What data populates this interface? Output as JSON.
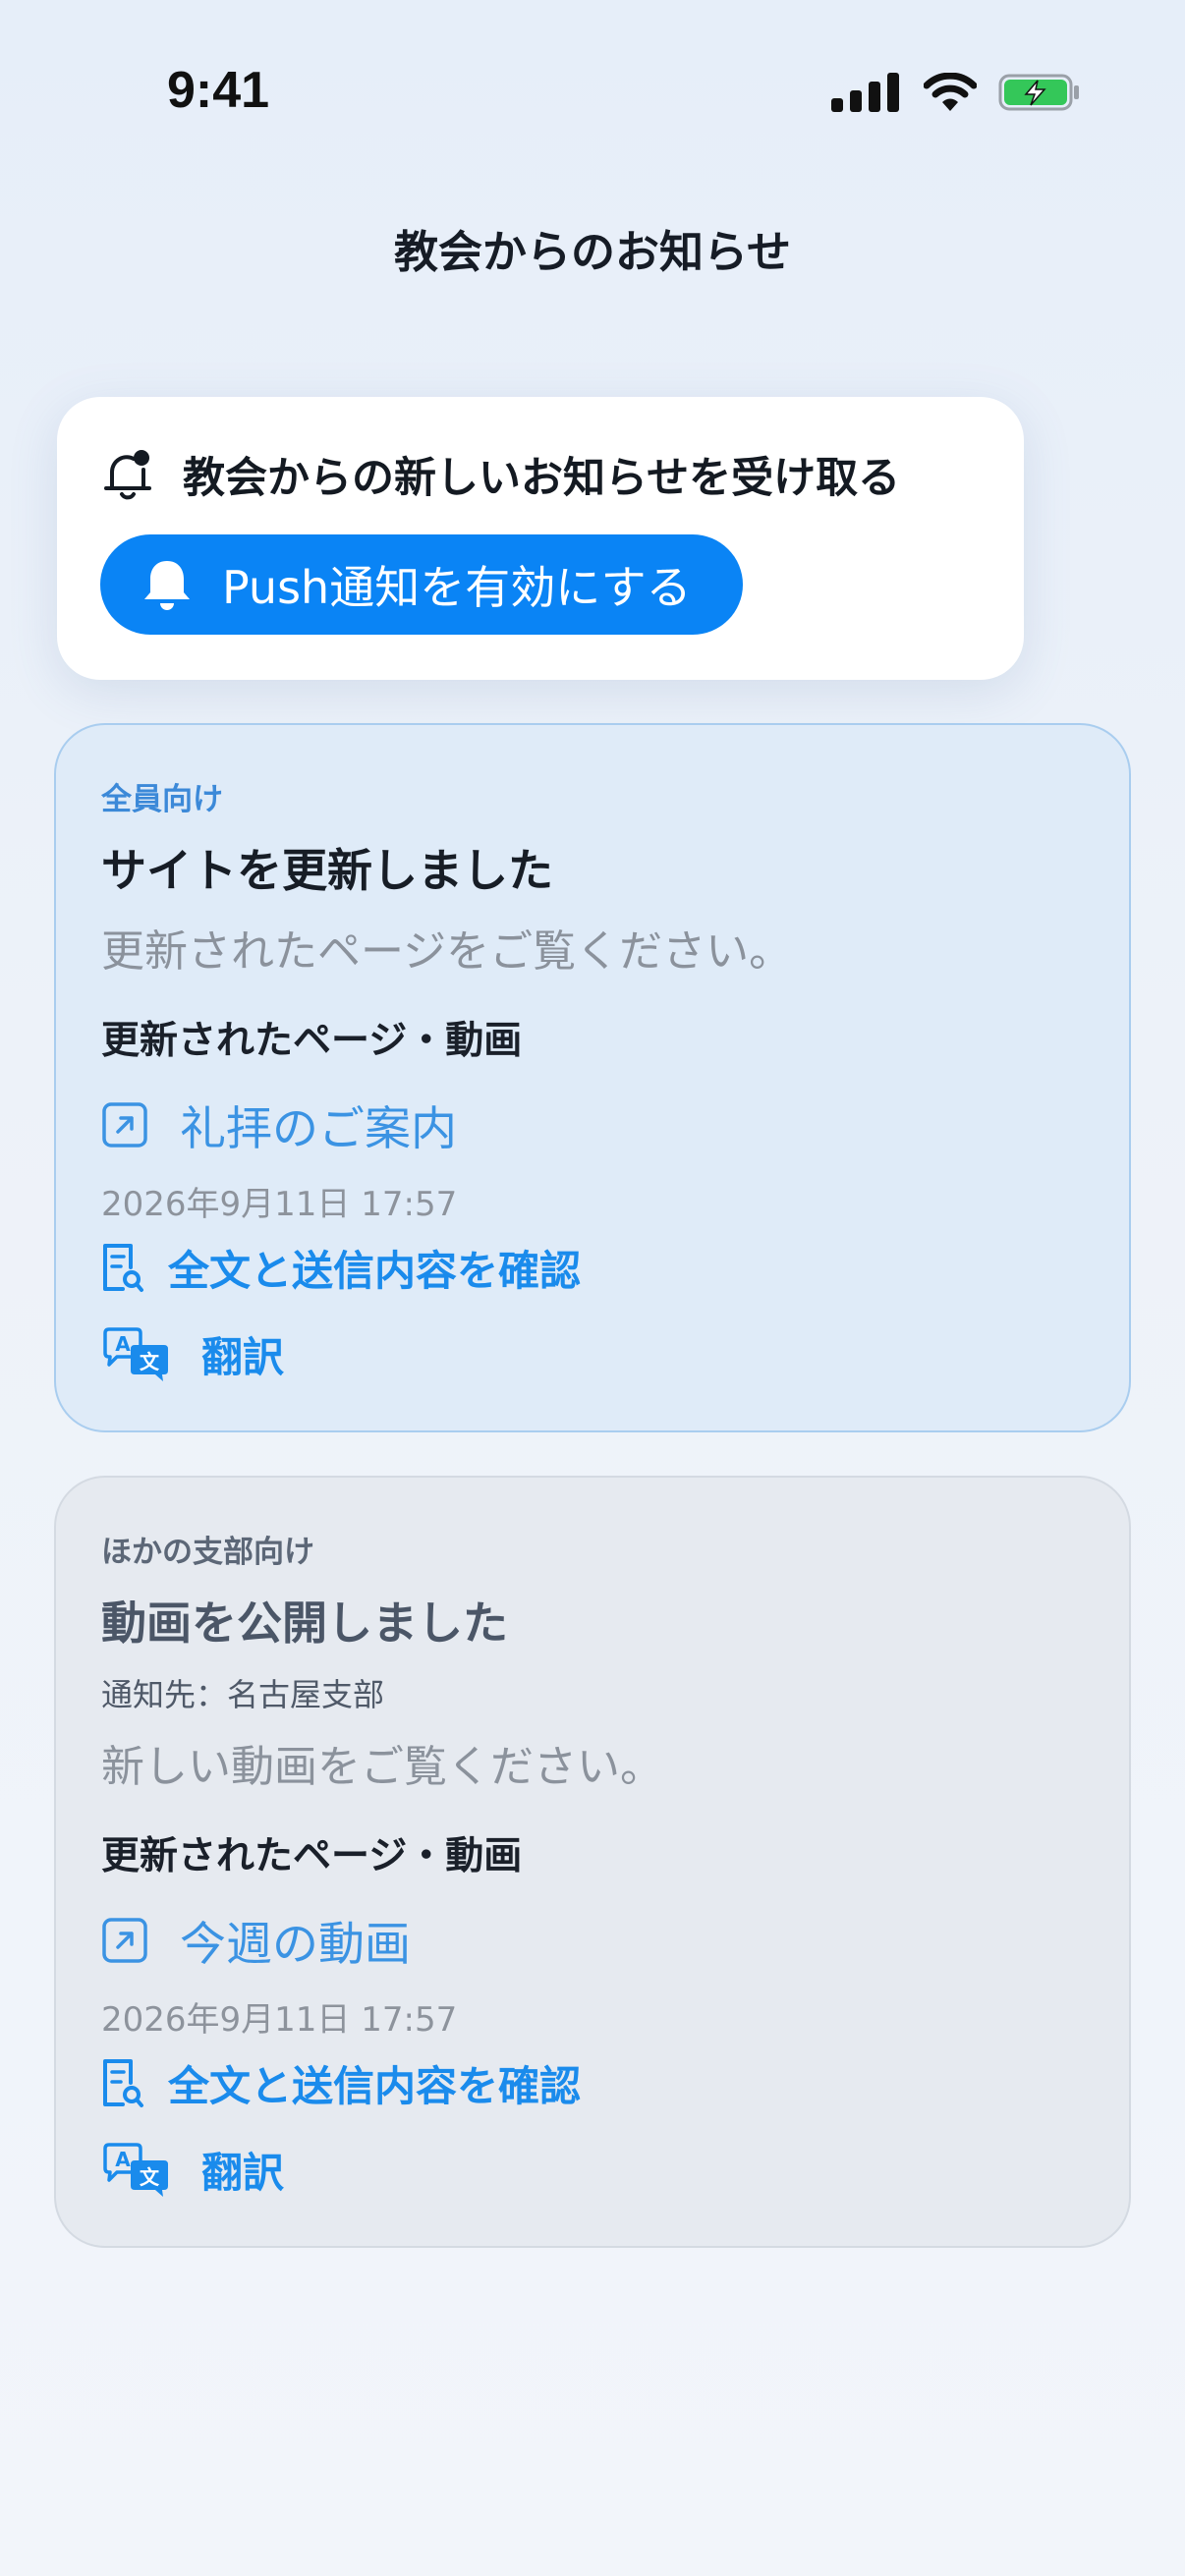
{
  "status_bar": {
    "time": "9:41"
  },
  "header": {
    "title": "教会からのお知らせ"
  },
  "push_card": {
    "heading": "教会からの新しいお知らせを受け取る",
    "button_label": "Push通知を有効にする",
    "accent_color": "#0a84f5"
  },
  "notices": [
    {
      "audience": "全員向け",
      "title": "サイトを更新しました",
      "body": "更新されたページをご覧ください。",
      "section_label": "更新されたページ・動画",
      "link_label": "礼拝のご案内",
      "timestamp": "2026年9月11日 17:57",
      "detail_label": "全文と送信内容を確認",
      "translate_label": "翻訳"
    },
    {
      "audience": "ほかの支部向け",
      "title": "動画を公開しました",
      "recipient": "通知先：名古屋支部",
      "body": "新しい動画をご覧ください。",
      "section_label": "更新されたページ・動画",
      "link_label": "今週の動画",
      "timestamp": "2026年9月11日 17:57",
      "detail_label": "全文と送信内容を確認",
      "translate_label": "翻訳"
    }
  ]
}
